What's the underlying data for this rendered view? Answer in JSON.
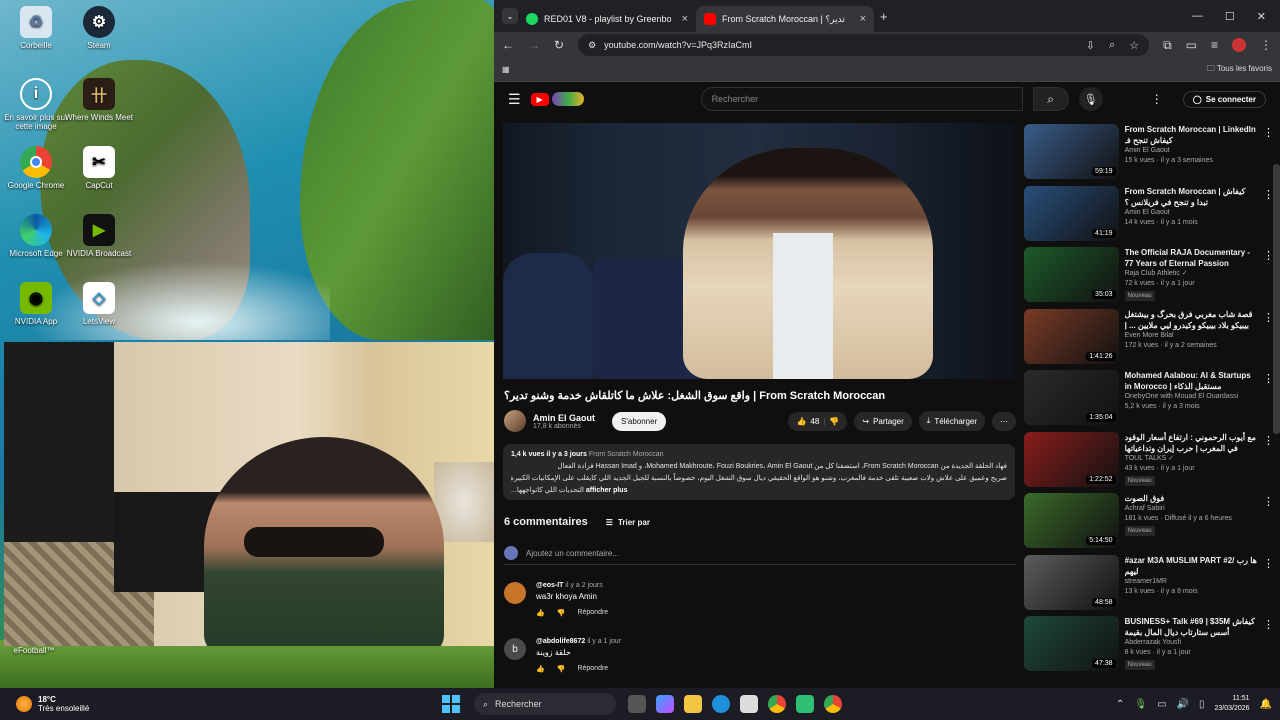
{
  "desktop": {
    "icons": [
      {
        "label": "Corbeille",
        "icon": "recycle-bin-icon"
      },
      {
        "label": "Steam",
        "icon": "steam-icon"
      },
      {
        "label": "En savoir plus sur cette image",
        "icon": "info-icon"
      },
      {
        "label": "Where Winds Meet",
        "icon": "game-icon"
      },
      {
        "label": "Google Chrome",
        "icon": "chrome-icon"
      },
      {
        "label": "CapCut",
        "icon": "capcut-icon"
      },
      {
        "label": "Microsoft Edge",
        "icon": "edge-icon"
      },
      {
        "label": "NVIDIA Broadcast",
        "icon": "nvidia-broadcast-icon"
      },
      {
        "label": "NVIDIA App",
        "icon": "nvidia-icon"
      },
      {
        "label": "LetsView",
        "icon": "letsview-icon"
      }
    ],
    "efootball_label": "eFootball™"
  },
  "browser": {
    "tabs": [
      {
        "title": "RED01 V8 - playlist by Greenbo",
        "active": false,
        "favicon_color": "#1ed760"
      },
      {
        "title": "From Scratch Moroccan | تدير؟",
        "active": true,
        "favicon_color": "#ff0000"
      }
    ],
    "url": "youtube.com/watch?v=JPq3RzIaCmI",
    "bookmarks_label": "Tous les favoris"
  },
  "youtube": {
    "search_placeholder": "Rechercher",
    "signin_label": "Se connecter",
    "video": {
      "title": "واقع سوق الشغل: علاش ما كاتلقاش خدمة وشنو تدير؟ | From Scratch Moroccan",
      "channel": "Amin El Gaout",
      "subscribers": "17,8 k abonnés",
      "subscribe_label": "S'abonner",
      "likes": "48",
      "share_label": "Partager",
      "download_label": "Télécharger",
      "views": "1,4 k vues",
      "date": "il y a 3 jours",
      "desc_tag": "From Scratch Moroccan",
      "desc_line1": "فهاد الحلقة الجديدة من From Scratch Moroccan، استضفنا كل من Mohamed Makhroute، Fouzi Boukries، Amin El Gaout، و Hassan Imad فرادة الفعال",
      "desc_line2": "صريح وعميق على علاش ولات صعيبة تلقى خدمة فالمغرب، وشنو هو الواقع الحقيقي ديال سوق الشغل اليوم، خصوصاً بالنسبة للجيل الجديد اللي كايقلب على الإمكانيات الكبيرة",
      "desc_line3": "...التحديات اللي كاتواجهها",
      "show_more": "afficher plus"
    },
    "comments": {
      "count_label": "6 commentaires",
      "sort_label": "Trier par",
      "add_placeholder": "Ajoutez un commentaire...",
      "reply_label": "Répondre",
      "items": [
        {
          "author": "@eos-IT",
          "time": "il y a 2 jours",
          "text": "wa3r khoya Amin",
          "avatar_color": "#c8742a"
        },
        {
          "author": "@abdolife8672",
          "time": "il y a 1 jour",
          "text": "حلقة زوينة",
          "avatar_color": "#4a4a4a",
          "initial": "b"
        }
      ]
    },
    "sidebar": [
      {
        "title": "From Scratch Moroccan | LinkedIn كيفاش تنجح فـ",
        "channel": "Amin El Gaout",
        "meta": "15 k vues · il y a 3 semaines",
        "duration": "59:19",
        "badge": "",
        "thumb": "#3a5c8a"
      },
      {
        "title": "From Scratch Moroccan | كيفاش تبدا و تنجح في فريلانس ؟",
        "channel": "Amin El Gaout",
        "meta": "14 k vues · il y a 1 mois",
        "duration": "41:19",
        "badge": "",
        "thumb": "#2a4f7c"
      },
      {
        "title": "The Official RAJA Documentary - 77 Years of Eternal Passion",
        "channel": "Raja Club Athletic ✓",
        "meta": "72 k vues · il y a 1 jour",
        "duration": "35:03",
        "badge": "Nouveau",
        "thumb": "#1d5a2a"
      },
      {
        "title": "قصة شاب مغربي فرق بحرگ و بيشتغل بيبيكو بلاد بيبيكو وكيدرو ليي ملايين ... | بحالي بالبتك",
        "channel": "Even More Bilal",
        "meta": "172 k vues · il y a 2 semaines",
        "duration": "1:41:26",
        "badge": "",
        "thumb": "#7a3b26"
      },
      {
        "title": "Mohamed Aalabou: AI & Startups in Morocco | مستقبل الذكاء",
        "channel": "OnebyOne with Mouad El Ouardassi",
        "meta": "5,2 k vues · il y a 3 mois",
        "duration": "1:35:04",
        "badge": "",
        "thumb": "#2b2b2b"
      },
      {
        "title": "مع أيوب الرحموني : ارتفاع أسعار الوقود في المغرب | حرب إيران وتداعياتها بالنسبة للبلد",
        "channel": "TOUL TALKS ✓",
        "meta": "43 k vues · il y a 1 jour",
        "duration": "1:22:52",
        "badge": "Nouveau",
        "thumb": "#8a1c1c"
      },
      {
        "title": "فوق الصوت",
        "channel": "Achraf Sabiri",
        "meta": "181 k vues · Diffusé il y a 6 heures",
        "duration": "5:14:50",
        "badge": "Nouveau",
        "thumb": "#3b6a2a"
      },
      {
        "title": "#azar M3A MUSLIM PART #2/ ها رب ليهم",
        "channel": "streamer1MR",
        "meta": "13 k vues · il y a 8 mois",
        "duration": "48:58",
        "badge": "",
        "thumb": "#5c5c5c"
      },
      {
        "title": "BUSINESS+ Talk #69 | $35M كيفاش أسس ستارتاب ديال المال بقيمة",
        "channel": "Abderrazak Yousfi",
        "meta": "8 k vues · il y a 1 jour",
        "duration": "47:38",
        "badge": "Nouveau",
        "thumb": "#1f4a3a"
      }
    ]
  },
  "taskbar": {
    "temp": "18°C",
    "weather": "Très ensoleillé",
    "search_label": "Rechercher",
    "time": "11:51",
    "date": "23/03/2026"
  }
}
